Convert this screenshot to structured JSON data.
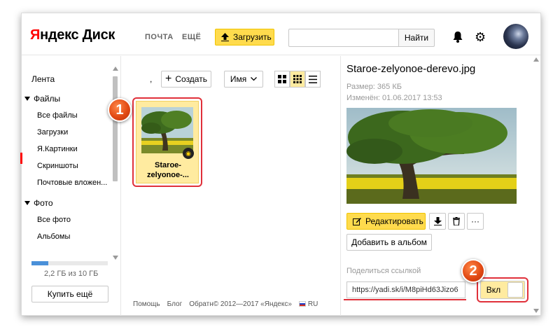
{
  "header": {
    "logo_y": "Я",
    "logo_rest": "ндекс",
    "logo_disk": "Диск",
    "nav": [
      "ПОЧТА",
      "ЕЩЁ"
    ],
    "upload_label": "Загрузить",
    "search_placeholder": "",
    "search_button": "Найти",
    "icons": [
      "bell-icon",
      "gear-icon",
      "upload-icon"
    ]
  },
  "sidebar": {
    "feed": "Лента",
    "files_section": "Файлы",
    "files": [
      "Все файлы",
      "Загрузки",
      "Я.Картинки",
      "Скриншоты",
      "Почтовые вложен..."
    ],
    "active_item": "Я.Картинки",
    "photo_section": "Фото",
    "photo": [
      "Все фото",
      "Альбомы"
    ],
    "storage_text": "2,2 ГБ из 10 ГБ",
    "storage_used_fraction": 0.22,
    "buy_more": "Купить ещё"
  },
  "toolbar": {
    "comma": ",",
    "create_label": "Создать",
    "sort_label": "Имя",
    "view_modes": [
      "large-tiles",
      "small-tiles",
      "list"
    ],
    "active_view": "small-tiles"
  },
  "file": {
    "name_line1": "Staroe-",
    "name_line2": "zelyonoe-..."
  },
  "annotations": {
    "badge1": "1",
    "badge2": "2",
    "accent": "#e0303a"
  },
  "footer": {
    "help": "Помощь",
    "blog": "Блог",
    "feedback": "Обратн",
    "copyright": "© 2012—2017 «Яндекс»",
    "lang": "RU"
  },
  "panel": {
    "title": "Staroe-zelyonoe-derevo.jpg",
    "size": "Размер: 365 КБ",
    "modified": "Изменён: 01.06.2017 13:53",
    "edit_label": "Редактировать",
    "album_label": "Добавить в альбом",
    "share_label": "Поделиться ссылкой",
    "share_link": "https://yadi.sk/i/M8piHd63Jizo6",
    "toggle_label": "Вкл",
    "toggle_on": true
  },
  "colors": {
    "yellow": "#ffdb4d",
    "selected": "#ffeba0",
    "logo_red": "#ff0000"
  }
}
